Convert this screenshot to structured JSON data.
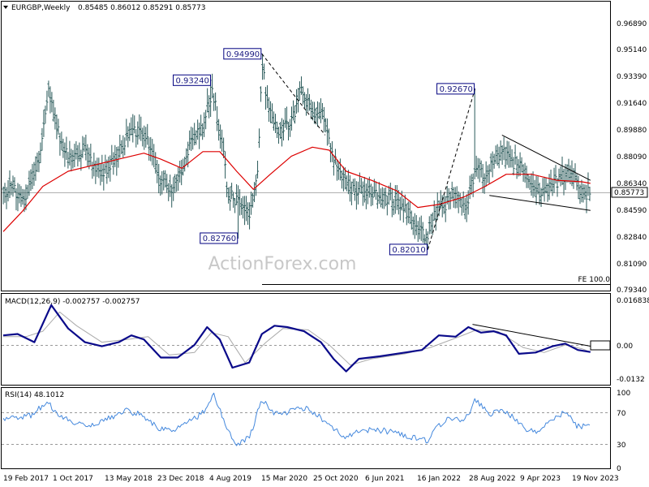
{
  "header": {
    "symbol": "EURGBP,Weekly",
    "ohlc": "0.85485 0.86012 0.85291 0.85773",
    "dropdown_icon": "triangle-down-icon"
  },
  "watermark": "ActionForex.com",
  "price_panel": {
    "ylabels": [
      "0.96890",
      "0.95140",
      "0.93390",
      "0.91640",
      "0.89880",
      "0.88090",
      "0.86340",
      "0.84590",
      "0.82840",
      "0.81090",
      "0.79340"
    ],
    "current_price_label": "0.85773",
    "fe_label": "FE 100.0",
    "point_labels": [
      "0.94990",
      "0.93240",
      "0.82760",
      "0.92670",
      "0.82010"
    ],
    "colors": {
      "price_bars": "#2a5a5a",
      "moving_average": "#dd0000",
      "trendline": "#000000",
      "hline": "#b0b0b0",
      "label_border": "#000080"
    }
  },
  "macd_panel": {
    "title": "MACD(12,26,9) -0.002757 -0.002757",
    "ylabels": [
      "0.016838",
      "0.00",
      "-0.0132"
    ],
    "colors": {
      "macd": "#0a0a8a",
      "signal": "#aaaaaa"
    }
  },
  "rsi_panel": {
    "title": "RSI(14) 48.1012",
    "ylabels": [
      "100",
      "70",
      "30",
      "0"
    ],
    "colors": {
      "rsi": "#4488dd"
    }
  },
  "xaxis": {
    "labels": [
      "19 Feb 2017",
      "1 Oct 2017",
      "13 May 2018",
      "23 Dec 2018",
      "4 Aug 2019",
      "15 Mar 2020",
      "25 Oct 2020",
      "6 Jun 2021",
      "16 Jan 2022",
      "28 Aug 2022",
      "9 Apr 2023",
      "19 Nov 2023"
    ]
  },
  "chart_data": [
    {
      "type": "ohlc",
      "title": "EURGBP,Weekly",
      "ylim": [
        0.7934,
        0.9859
      ],
      "last_close": 0.85773,
      "close_path": [
        [
          2017.13,
          0.855
        ],
        [
          2017.25,
          0.863
        ],
        [
          2017.35,
          0.85
        ],
        [
          2017.55,
          0.88
        ],
        [
          2017.66,
          0.925
        ],
        [
          2017.75,
          0.905
        ],
        [
          2017.9,
          0.88
        ],
        [
          2018.1,
          0.888
        ],
        [
          2018.25,
          0.87
        ],
        [
          2018.45,
          0.878
        ],
        [
          2018.55,
          0.89
        ],
        [
          2018.7,
          0.9
        ],
        [
          2018.85,
          0.89
        ],
        [
          2019.0,
          0.865
        ],
        [
          2019.15,
          0.858
        ],
        [
          2019.35,
          0.89
        ],
        [
          2019.5,
          0.902
        ],
        [
          2019.61,
          0.925
        ],
        [
          2019.7,
          0.9
        ],
        [
          2019.8,
          0.858
        ],
        [
          2019.95,
          0.848
        ],
        [
          2020.05,
          0.845
        ],
        [
          2020.15,
          0.87
        ],
        [
          2020.2,
          0.945
        ],
        [
          2020.26,
          0.92
        ],
        [
          2020.4,
          0.9
        ],
        [
          2020.55,
          0.905
        ],
        [
          2020.68,
          0.925
        ],
        [
          2020.8,
          0.91
        ],
        [
          2020.9,
          0.915
        ],
        [
          2021.0,
          0.89
        ],
        [
          2021.15,
          0.865
        ],
        [
          2021.3,
          0.86
        ],
        [
          2021.5,
          0.858
        ],
        [
          2021.7,
          0.855
        ],
        [
          2021.9,
          0.845
        ],
        [
          2022.05,
          0.835
        ],
        [
          2022.15,
          0.828
        ],
        [
          2022.25,
          0.843
        ],
        [
          2022.4,
          0.852
        ],
        [
          2022.5,
          0.858
        ],
        [
          2022.6,
          0.845
        ],
        [
          2022.75,
          0.875
        ],
        [
          2022.85,
          0.865
        ],
        [
          2022.95,
          0.88
        ],
        [
          2023.05,
          0.885
        ],
        [
          2023.15,
          0.88
        ],
        [
          2023.35,
          0.87
        ],
        [
          2023.5,
          0.858
        ],
        [
          2023.6,
          0.86
        ],
        [
          2023.75,
          0.868
        ],
        [
          2023.85,
          0.87
        ],
        [
          2023.95,
          0.862
        ],
        [
          2024.05,
          0.858
        ],
        [
          2024.1,
          0.8577
        ]
      ],
      "moving_average_path": [
        [
          2017.13,
          0.832
        ],
        [
          2017.35,
          0.845
        ],
        [
          2017.6,
          0.862
        ],
        [
          2017.9,
          0.872
        ],
        [
          2018.2,
          0.876
        ],
        [
          2018.5,
          0.88
        ],
        [
          2018.8,
          0.884
        ],
        [
          2019.0,
          0.88
        ],
        [
          2019.25,
          0.874
        ],
        [
          2019.5,
          0.885
        ],
        [
          2019.7,
          0.885
        ],
        [
          2019.9,
          0.872
        ],
        [
          2020.1,
          0.86
        ],
        [
          2020.3,
          0.87
        ],
        [
          2020.55,
          0.882
        ],
        [
          2020.8,
          0.888
        ],
        [
          2021.0,
          0.886
        ],
        [
          2021.2,
          0.872
        ],
        [
          2021.5,
          0.866
        ],
        [
          2021.8,
          0.859
        ],
        [
          2022.05,
          0.848
        ],
        [
          2022.3,
          0.85
        ],
        [
          2022.6,
          0.855
        ],
        [
          2022.85,
          0.862
        ],
        [
          2023.1,
          0.87
        ],
        [
          2023.4,
          0.87
        ],
        [
          2023.7,
          0.866
        ],
        [
          2024.0,
          0.865
        ],
        [
          2024.1,
          0.864
        ]
      ],
      "swing_points": [
        {
          "x": 2020.2,
          "y": 0.9499
        },
        {
          "x": 2019.6,
          "y": 0.9324
        },
        {
          "x": 2019.92,
          "y": 0.8276
        },
        {
          "x": 2022.73,
          "y": 0.9267
        },
        {
          "x": 2022.17,
          "y": 0.8201
        }
      ],
      "trendlines": [
        {
          "from": [
            2020.2,
            0.9499
          ],
          "to": [
            2020.95,
            0.896
          ]
        },
        {
          "from": [
            2022.17,
            0.8201
          ],
          "to": [
            2022.73,
            0.9267
          ]
        },
        {
          "from": [
            2023.05,
            0.896
          ],
          "to": [
            2024.1,
            0.866
          ]
        },
        {
          "from": [
            2022.9,
            0.856
          ],
          "to": [
            2024.1,
            0.846
          ]
        }
      ],
      "reference_level": 0.8577,
      "fe_level": 0.7962
    },
    {
      "type": "line",
      "title": "MACD(12,26,9) -0.002757 -0.002757",
      "ylim": [
        -0.0132,
        0.016838
      ],
      "series": [
        {
          "name": "MACD",
          "path": [
            [
              2017.13,
              0.0035
            ],
            [
              2017.3,
              0.004
            ],
            [
              2017.5,
              0.001
            ],
            [
              2017.7,
              0.0145
            ],
            [
              2017.9,
              0.006
            ],
            [
              2018.1,
              0.001
            ],
            [
              2018.3,
              -0.0005
            ],
            [
              2018.5,
              0.001
            ],
            [
              2018.65,
              0.0035
            ],
            [
              2018.8,
              0.002
            ],
            [
              2019.0,
              -0.005
            ],
            [
              2019.2,
              -0.005
            ],
            [
              2019.4,
              0.0
            ],
            [
              2019.55,
              0.0065
            ],
            [
              2019.7,
              0.002
            ],
            [
              2019.85,
              -0.009
            ],
            [
              2020.05,
              -0.007
            ],
            [
              2020.2,
              0.004
            ],
            [
              2020.35,
              0.007
            ],
            [
              2020.5,
              0.0065
            ],
            [
              2020.7,
              0.005
            ],
            [
              2020.9,
              0.001
            ],
            [
              2021.05,
              -0.0055
            ],
            [
              2021.2,
              -0.0105
            ],
            [
              2021.35,
              -0.0055
            ],
            [
              2021.6,
              -0.0045
            ],
            [
              2021.9,
              -0.003
            ],
            [
              2022.1,
              -0.002
            ],
            [
              2022.3,
              0.0035
            ],
            [
              2022.5,
              0.003
            ],
            [
              2022.65,
              0.0065
            ],
            [
              2022.8,
              0.0045
            ],
            [
              2022.95,
              0.005
            ],
            [
              2023.1,
              0.0035
            ],
            [
              2023.25,
              -0.0035
            ],
            [
              2023.45,
              -0.003
            ],
            [
              2023.65,
              -0.0005
            ],
            [
              2023.8,
              0.0005
            ],
            [
              2023.95,
              -0.002
            ],
            [
              2024.1,
              -0.0028
            ]
          ]
        },
        {
          "name": "Signal",
          "path": [
            [
              2017.13,
              0.003
            ],
            [
              2017.4,
              0.003
            ],
            [
              2017.6,
              0.005
            ],
            [
              2017.8,
              0.012
            ],
            [
              2018.0,
              0.007
            ],
            [
              2018.3,
              0.001
            ],
            [
              2018.6,
              0.002
            ],
            [
              2018.85,
              0.003
            ],
            [
              2019.1,
              -0.004
            ],
            [
              2019.4,
              -0.003
            ],
            [
              2019.6,
              0.0045
            ],
            [
              2019.8,
              0.003
            ],
            [
              2020.0,
              -0.007
            ],
            [
              2020.25,
              0.001
            ],
            [
              2020.45,
              0.006
            ],
            [
              2020.75,
              0.0055
            ],
            [
              2021.0,
              0.0
            ],
            [
              2021.25,
              -0.008
            ],
            [
              2021.5,
              -0.0055
            ],
            [
              2021.9,
              -0.0035
            ],
            [
              2022.2,
              -0.001
            ],
            [
              2022.5,
              0.0025
            ],
            [
              2022.75,
              0.0055
            ],
            [
              2023.0,
              0.005
            ],
            [
              2023.3,
              -0.001
            ],
            [
              2023.55,
              -0.003
            ],
            [
              2023.8,
              0.0
            ],
            [
              2024.0,
              -0.0015
            ],
            [
              2024.1,
              -0.0028
            ]
          ]
        }
      ],
      "trendline": {
        "from": [
          2022.7,
          0.0075
        ],
        "to": [
          2024.1,
          -0.0005
        ]
      }
    },
    {
      "type": "line",
      "title": "RSI(14) 48.1012",
      "ylim": [
        0,
        100
      ],
      "series": [
        {
          "name": "RSI",
          "path": [
            [
              2017.13,
              52
            ],
            [
              2017.3,
              55
            ],
            [
              2017.5,
              58
            ],
            [
              2017.65,
              72
            ],
            [
              2017.8,
              55
            ],
            [
              2018.0,
              50
            ],
            [
              2018.2,
              48
            ],
            [
              2018.4,
              55
            ],
            [
              2018.6,
              62
            ],
            [
              2018.8,
              56
            ],
            [
              2019.0,
              44
            ],
            [
              2019.15,
              42
            ],
            [
              2019.35,
              52
            ],
            [
              2019.55,
              62
            ],
            [
              2019.62,
              80
            ],
            [
              2019.75,
              52
            ],
            [
              2019.9,
              28
            ],
            [
              2020.05,
              36
            ],
            [
              2020.2,
              72
            ],
            [
              2020.35,
              58
            ],
            [
              2020.5,
              60
            ],
            [
              2020.7,
              64
            ],
            [
              2020.9,
              55
            ],
            [
              2021.05,
              45
            ],
            [
              2021.2,
              35
            ],
            [
              2021.3,
              42
            ],
            [
              2021.5,
              44
            ],
            [
              2021.7,
              42
            ],
            [
              2021.9,
              38
            ],
            [
              2022.05,
              35
            ],
            [
              2022.17,
              32
            ],
            [
              2022.3,
              48
            ],
            [
              2022.45,
              55
            ],
            [
              2022.6,
              50
            ],
            [
              2022.73,
              72
            ],
            [
              2022.9,
              58
            ],
            [
              2023.05,
              62
            ],
            [
              2023.2,
              55
            ],
            [
              2023.35,
              44
            ],
            [
              2023.5,
              42
            ],
            [
              2023.65,
              55
            ],
            [
              2023.8,
              60
            ],
            [
              2023.95,
              46
            ],
            [
              2024.1,
              48
            ]
          ]
        }
      ],
      "reference_levels": [
        70,
        30
      ]
    }
  ]
}
